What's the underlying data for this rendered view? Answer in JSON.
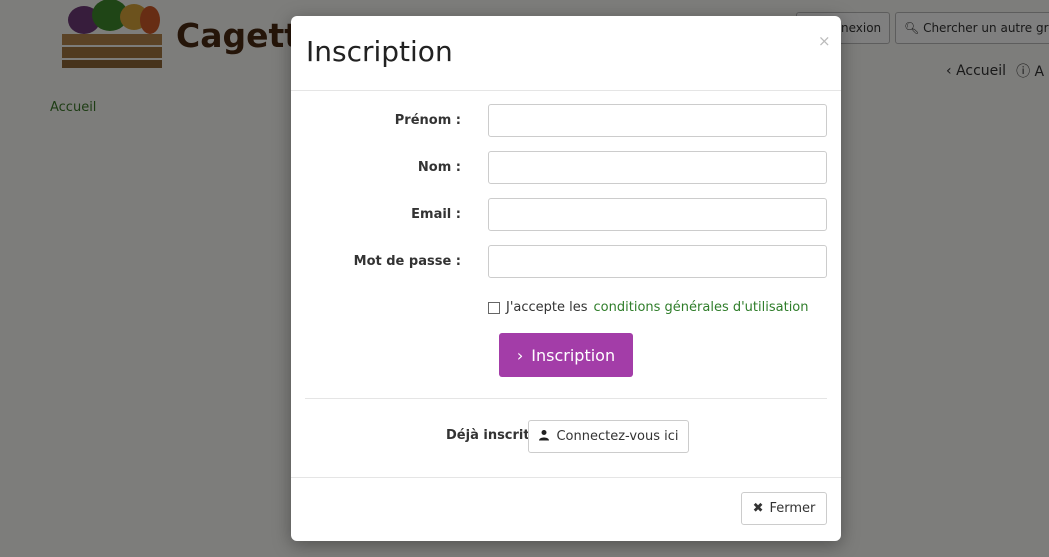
{
  "app": {
    "brand": "Cagette"
  },
  "header": {
    "connexion_label": "nexion",
    "search_label": "Chercher un autre groupe",
    "home_label": "Accueil",
    "info_label": "A"
  },
  "breadcrumb": {
    "label": "Accueil"
  },
  "modal": {
    "title": "Inscription",
    "close_symbol": "×",
    "fields": [
      {
        "label": "Prénom :",
        "value": "",
        "placeholder": ""
      },
      {
        "label": "Nom :",
        "value": "",
        "placeholder": ""
      },
      {
        "label": "Email :",
        "value": "",
        "placeholder": ""
      },
      {
        "label": "Mot de passe :",
        "value": "",
        "placeholder": ""
      }
    ],
    "terms_prefix": "J'accepte les",
    "terms_link": "conditions générales d'utilisation",
    "submit_label": "Inscription",
    "already_label": "Déjà inscrit ?",
    "login_label": "Connectez-vous ici",
    "close_label": "Fermer"
  },
  "colors": {
    "primary": "#a33da8",
    "link": "#2f7d2a",
    "overlay": "rgba(0,0,0,0.5)"
  },
  "icons": {
    "search": "search-icon",
    "chevron_left": "chevron-left-icon",
    "info": "info-icon",
    "chevron_right": "chevron-right-icon",
    "user": "user-icon",
    "close": "close-icon"
  }
}
